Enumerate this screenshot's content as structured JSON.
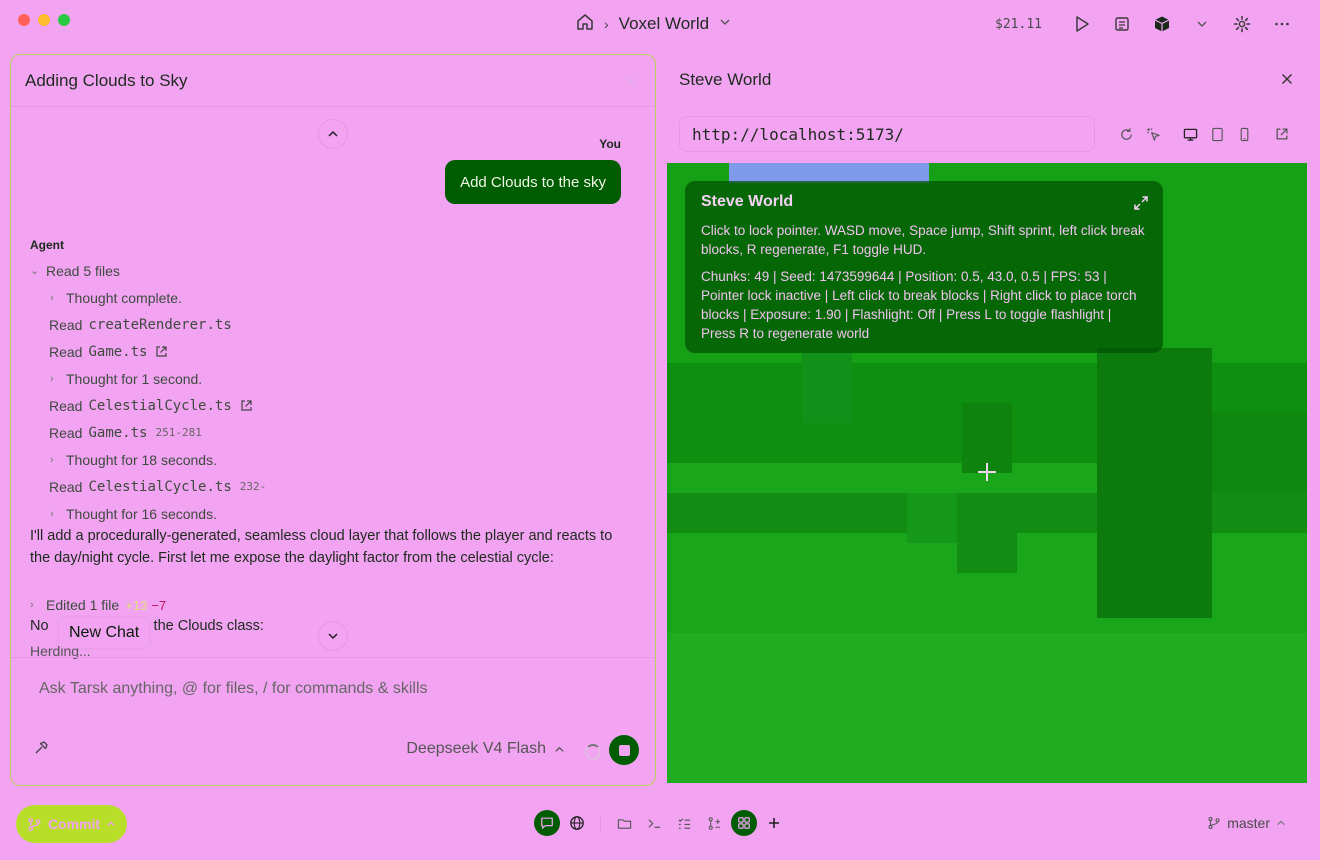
{
  "titlebar": {
    "project_name": "Voxel World",
    "cost": "$21.11"
  },
  "chat": {
    "title": "Adding Clouds to Sky",
    "you_label": "You",
    "user_message": "Add Clouds to the sky",
    "agent_label": "Agent",
    "trace": {
      "group_label": "Read 5 files",
      "thought_complete": "Thought complete.",
      "read_verb": "Read",
      "file1": "createRenderer.ts",
      "file2": "Game.ts",
      "thought_1s": "Thought for 1 second.",
      "file3": "CelestialCycle.ts",
      "file4": "Game.ts",
      "file4_range": "251-281",
      "thought_18s": "Thought for 18 seconds.",
      "file5": "CelestialCycle.ts",
      "file5_range": "232-",
      "thought_16s": "Thought for 16 seconds."
    },
    "agent_paragraph": "I'll add a procedurally-generated, seamless cloud layer that follows the player and reacts to the day/night cycle. First let me expose the daylight factor from the celestial cycle:",
    "edited_label": "Edited 1 file",
    "edited_plus": "+13",
    "edited_minus": "−7",
    "next_line_start": "No",
    "next_line_end": "the Clouds class:",
    "status": "Herding...",
    "tooltip": "New Chat",
    "input_placeholder": "Ask Tarsk anything, @ for files, / for commands & skills",
    "model": "Deepseek V4 Flash"
  },
  "preview": {
    "title": "Steve World",
    "url": "http://localhost:5173/",
    "hud": {
      "title": "Steve World",
      "instructions": "Click to lock pointer. WASD move, Space jump, Shift sprint, left click break blocks, R regenerate, F1 toggle HUD.",
      "stats": "Chunks: 49 | Seed: 1473599644 | Position: 0.5, 43.0, 0.5 | FPS: 53 | Pointer lock inactive | Left click to break blocks | Right click to place torch blocks | Exposure: 1.90 | Flashlight: Off | Press L to toggle flashlight | Press R to regenerate world"
    }
  },
  "bottombar": {
    "commit_label": "Commit",
    "branch": "master"
  },
  "colors": {
    "background": "#f2a4f2",
    "accent_dark_green": "#005c00",
    "commit_lime": "#b9de2a",
    "panel_border": "#b7d35a"
  }
}
